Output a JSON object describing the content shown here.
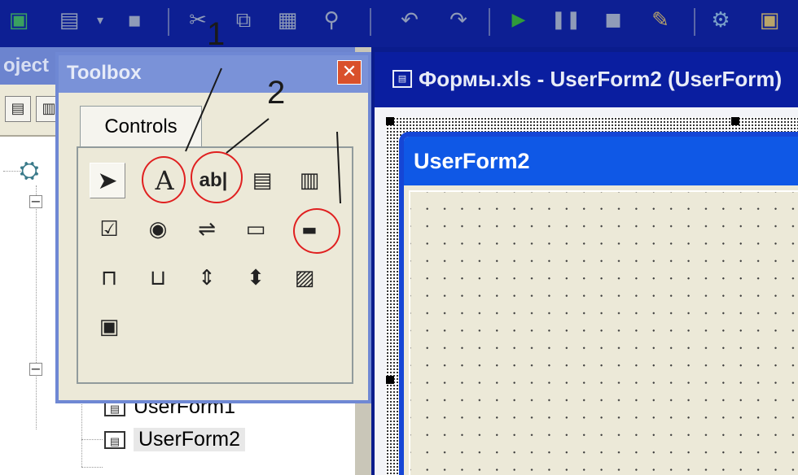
{
  "toolbar": {
    "icons": [
      "excel-icon",
      "insert-userform-icon",
      "dropdown-arrow-icon",
      "save-icon",
      "cut-icon",
      "copy-icon",
      "paste-icon",
      "find-icon",
      "undo-icon",
      "redo-icon",
      "run-icon",
      "pause-icon",
      "stop-icon",
      "design-mode-icon",
      "project-explorer-icon",
      "properties-icon"
    ]
  },
  "project_panel": {
    "title": "oject",
    "tree": {
      "expander_collapse": "−",
      "item_userform1": "UserForm1",
      "item_userform2": "UserForm2"
    }
  },
  "toolbox": {
    "title": "Toolbox",
    "close_glyph": "✕",
    "tab_label": "Controls",
    "label_tool_glyph": "A",
    "textbox_tool_glyph": "ab|"
  },
  "annotations": {
    "num1": "1",
    "num2": "2"
  },
  "designer": {
    "title": "Формы.xls - UserForm2 (UserForm)",
    "form_caption": "UserForm2"
  },
  "colors": {
    "desktop": "#0a1c8c",
    "annotation_circle": "#e02020",
    "form_titlebar": "#0f58e6"
  }
}
